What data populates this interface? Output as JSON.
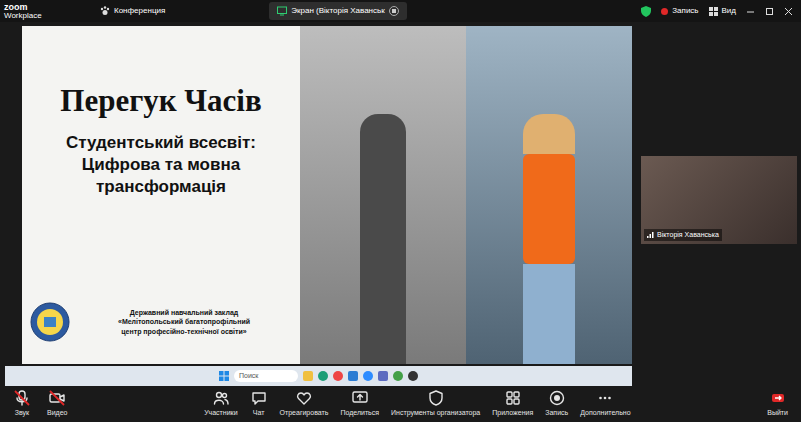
{
  "app": {
    "logo": "zoom",
    "logo_sub": "Workplace"
  },
  "tabs": [
    {
      "label": "Конференция",
      "selected": false,
      "kind": "paw"
    },
    {
      "label": "Экран (Вікторія Хаванськ",
      "selected": true,
      "kind": "screen"
    }
  ],
  "top_right": {
    "recording": "Запись",
    "view": "Вид"
  },
  "slide": {
    "title": "Перегук Часів",
    "subtitle_lines": [
      "Студентський всесвіт:",
      "Цифрова та мовна",
      "трансформація"
    ],
    "institution_lines": [
      "Державний навчальний заклад",
      "«Мелітопольський багатопрофільний",
      "центр професійно-технічної освіти»"
    ]
  },
  "taskbar": {
    "search_placeholder": "Поиск"
  },
  "participant": {
    "name": "Вікторія Хаванська"
  },
  "toolbar": [
    {
      "label": "Звук",
      "kind": "mic",
      "muted": true
    },
    {
      "label": "Видео",
      "kind": "video",
      "muted": true
    },
    {
      "label": "Участники",
      "kind": "people",
      "muted": false
    },
    {
      "label": "Чат",
      "kind": "chat",
      "muted": false
    },
    {
      "label": "Отреагировать",
      "kind": "react",
      "muted": false
    },
    {
      "label": "Поделиться",
      "kind": "share",
      "muted": false
    },
    {
      "label": "Инструменты организатора",
      "kind": "tools",
      "muted": false
    },
    {
      "label": "Приложения",
      "kind": "apps",
      "muted": false
    },
    {
      "label": "Запись",
      "kind": "record",
      "muted": false
    },
    {
      "label": "Дополнительно",
      "kind": "more",
      "muted": false
    },
    {
      "label": "Выйти",
      "kind": "leave",
      "muted": false
    }
  ]
}
